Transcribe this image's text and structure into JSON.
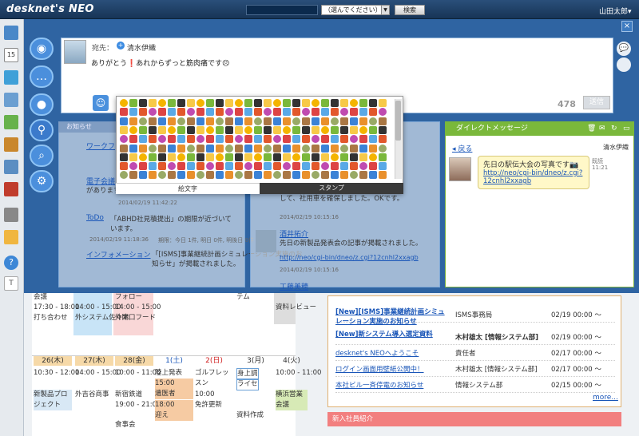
{
  "app": {
    "logo": "desknet's NEO",
    "user": "山田太郎",
    "search_select": "（選んでください）",
    "search_button": "検索"
  },
  "composer": {
    "to_label": "宛先：",
    "to_name": "清水伊織",
    "message": "ありがとう❗あれからずっと筋肉痛です😣",
    "char_count": "478",
    "send": "送信"
  },
  "emoji_tabs": {
    "emoji": "絵文字",
    "stamp": "スタンプ"
  },
  "notice": {
    "title": "お知らせ",
    "items": [
      {
        "link": "ワークフ",
        "text": "...",
        "date": ""
      },
      {
        "link": "電子会議",
        "text": "があります",
        "date": ""
      },
      {
        "date": "2014/02/19 11:42:22"
      },
      {
        "link": "ToDo",
        "text": "「ABHD社見積提出」の期限が近づいています。",
        "date": "2014/02/19 11:18:36",
        "meta": "期限：今日 1件, 明日 0件, 明後日 0件"
      },
      {
        "link": "インフォメーション",
        "text": "「[ISMS]事業継続計画シミュレーション実施のお知らせ」が掲載されました。",
        "date": ""
      }
    ]
  },
  "feed": {
    "items": [
      {
        "text": "して、社用車を確保しました。OKです。",
        "date": "2014/02/19 10:15:16"
      },
      {
        "name": "酒井拓介",
        "text": "先日の新製品発表会の記事が掲載されました。",
        "link": "http://neo/cgi-bin/dneo/z.cgi?12cnhl2xxagb",
        "date": "2014/02/19 10:15:16"
      },
      {
        "name": "工藤美穂"
      }
    ]
  },
  "dm": {
    "title": "ダイレクトメッセージ",
    "back": "戻る",
    "name": "清水伊織",
    "message": "先日の駅伝大会の写真です📷",
    "link": "http://neo/cgi-bin/dneo/z.cgi?12cnhl2xxagb",
    "read": "既読",
    "time": "11:21"
  },
  "calendar": {
    "top_events": [
      "会議",
      "17:30 - 18:00",
      "打ち合わせ",
      "14:00 - 15:00",
      "外システム佐々木",
      "フォロー",
      "14:00 - 15:00",
      "外関口フード",
      "テム",
      "資料レビュー"
    ],
    "days": [
      {
        "label": "26(木)",
        "events": [
          "10:30 - 12:00",
          "新製品プロジェクト"
        ]
      },
      {
        "label": "27(木)",
        "events": [
          "14:00 - 15:00",
          "外吉谷商事"
        ]
      },
      {
        "label": "28(金)",
        "events": [
          "10:00 - 11:00",
          "新宿鉄道",
          "19:00 - 21:00",
          "食事会"
        ]
      },
      {
        "label": "1(土)",
        "events": [
          "陸上発表",
          "15:00",
          "遺医者",
          "18:00",
          "迎え"
        ]
      },
      {
        "label": "2(日)",
        "events": [
          "ゴルフレッスン",
          "10:00",
          "免許更新"
        ]
      },
      {
        "label": "3(月)",
        "events": [
          "身上調",
          "ライセ",
          "資料作成"
        ]
      },
      {
        "label": "4(火)",
        "events": [
          "10:00 - 11:00",
          "横浜営業会議"
        ]
      }
    ]
  },
  "news": {
    "rows": [
      {
        "title": "[New][ISMS]事業継続計画シミュレーション実施のお知らせ",
        "dept": "ISMS事務局",
        "date": "02/19 00:00 ～"
      },
      {
        "title": "[New]新システム導入選定資料",
        "dept": "木村雄太 [情報システム部]",
        "date": "02/19 00:00 ～"
      },
      {
        "title": "desknet's NEOへようこそ",
        "dept": "責任者",
        "date": "02/17 00:00 ～"
      },
      {
        "title": "ログイン画面用壁紙公開中！",
        "dept": "木村雄太 [情報システム部]",
        "date": "02/17 00:00 ～"
      },
      {
        "title": "本社ビル一斉停電のお知らせ",
        "dept": "情報システム部",
        "date": "02/15 00:00 ～"
      }
    ],
    "more": "more..."
  },
  "intro": {
    "title": "新入社員紹介"
  }
}
